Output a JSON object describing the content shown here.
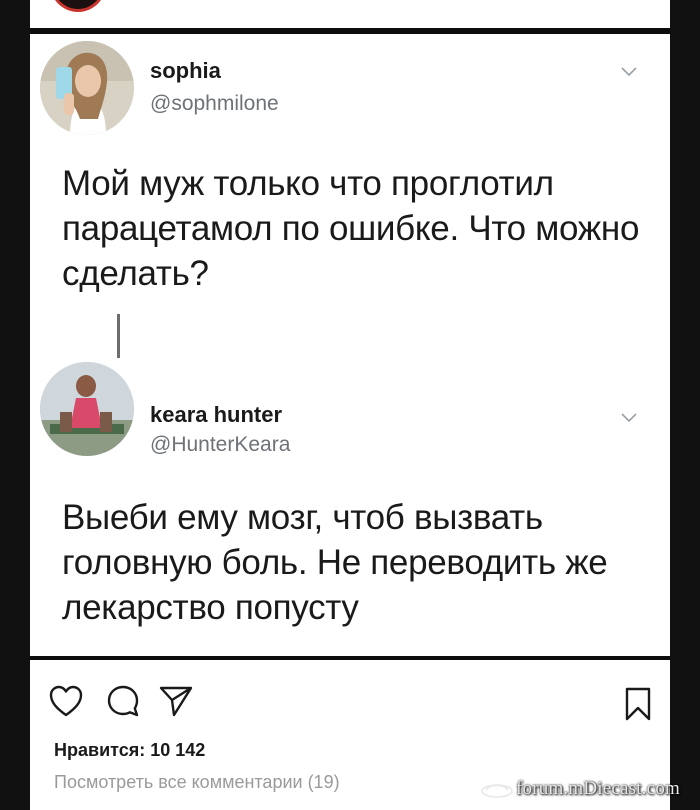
{
  "post": {
    "tweets": [
      {
        "display_name": "sophia",
        "handle": "@sophmilone",
        "text": "Мой муж только что проглотил парацетамол по ошибке. Что можно сделать?"
      },
      {
        "display_name": "keara hunter",
        "handle": "@HunterKeara",
        "text": "Выеби ему мозг, чтоб вызвать головную боль. Не переводить же лекарство попусту"
      }
    ],
    "likes_text": "Нравится: 10 142",
    "view_comments_text": "Посмотреть все комментарии (19)"
  },
  "icons": {
    "tweet_menu": "chevron-down-icon",
    "like": "heart-icon",
    "comment": "comment-icon",
    "share": "send-icon",
    "save": "bookmark-icon"
  },
  "watermark": {
    "text": "forum.mDiecast.com"
  },
  "colors": {
    "text": "#1a1a1a",
    "secondary_text": "#6e7378",
    "muted_text": "#9a9a9a",
    "background": "#ffffff",
    "frame": "#0d0d0d"
  }
}
